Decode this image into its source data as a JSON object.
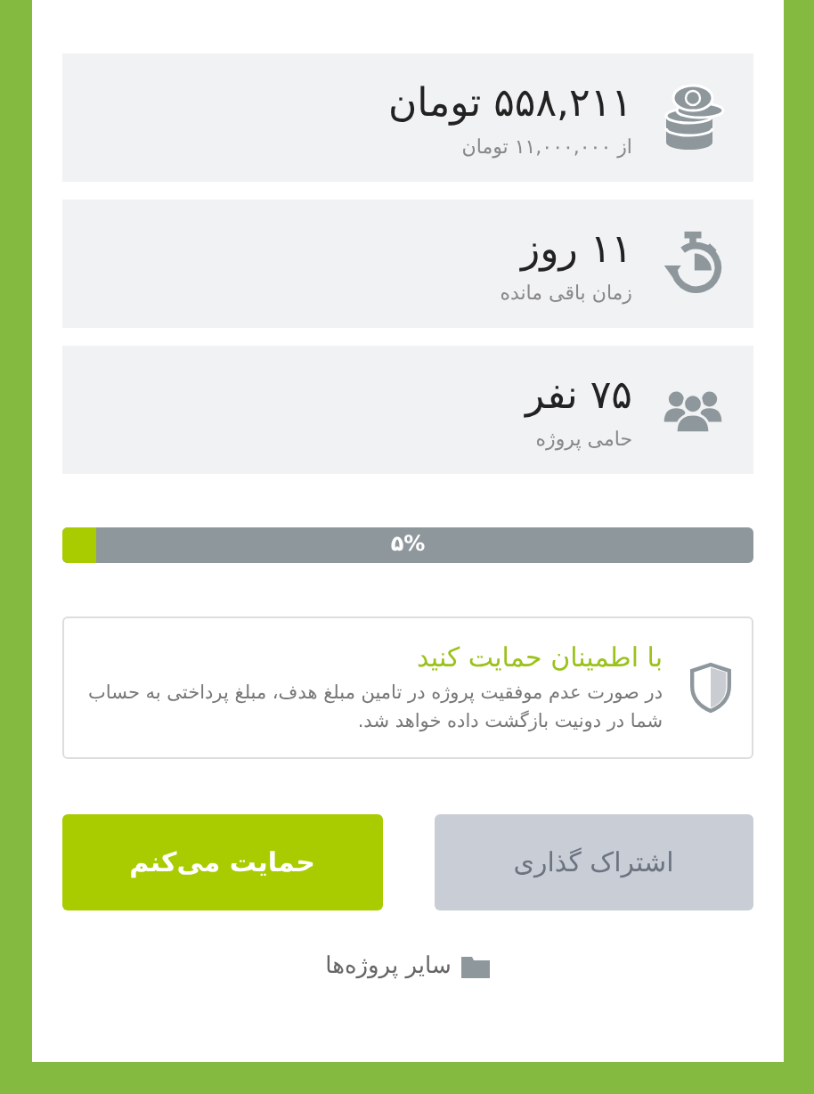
{
  "stats": [
    {
      "kind": "coins",
      "value": "۵۵۸,۲۱۱ تومان",
      "caption": "از ۱۱,۰۰۰,۰۰۰ تومان"
    },
    {
      "kind": "timer",
      "value": "۱۱ روز",
      "caption": "زمان باقی مانده"
    },
    {
      "kind": "people",
      "value": "۷۵ نفر",
      "caption": "حامی پروژه"
    }
  ],
  "progress": {
    "level": 0.05,
    "label": "۵%"
  },
  "guarantee": {
    "title": "با اطمینان حمایت کنید",
    "text": "در صورت عدم موفقیت پروژه در تامین مبلغ هدف، مبلغ پرداختی به حساب شما در دونیت بازگشت داده خواهد شد."
  },
  "buttons": [
    {
      "kind": "secondary",
      "label": "اشتراک گذاری"
    },
    {
      "kind": "primary",
      "label": "حمایت می‌کنم"
    }
  ],
  "other_projects": "سایر پروژه‌ها"
}
